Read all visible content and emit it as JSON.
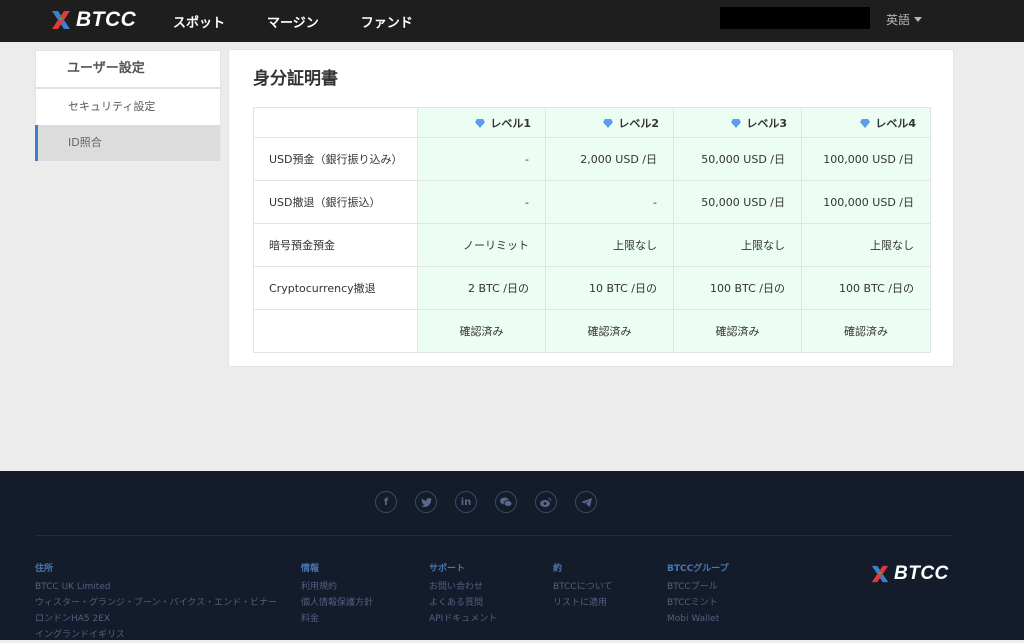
{
  "header": {
    "logo_text": "BTCC",
    "nav": [
      "スポット",
      "マージン",
      "ファンド"
    ],
    "language": "英語"
  },
  "sidebar": {
    "heading": "ユーザー設定",
    "items": [
      "セキュリティ設定",
      "ID照合"
    ],
    "active_index": 1
  },
  "main": {
    "title": "身分証明書",
    "levels": [
      "レベル1",
      "レベル2",
      "レベル3",
      "レベル4"
    ],
    "rows": [
      {
        "label": "USD預金（銀行振り込み）",
        "values": [
          "-",
          "2,000 USD /日",
          "50,000 USD /日",
          "100,000 USD /日"
        ]
      },
      {
        "label": "USD撤退（銀行振込）",
        "values": [
          "-",
          "-",
          "50,000 USD /日",
          "100,000 USD /日"
        ]
      },
      {
        "label": "暗号預金預金",
        "values": [
          "ノーリミット",
          "上限なし",
          "上限なし",
          "上限なし"
        ]
      },
      {
        "label": "Cryptocurrency撤退",
        "values": [
          "2 BTC /日の",
          "10 BTC /日の",
          "100 BTC /日の",
          "100 BTC /日の"
        ]
      }
    ],
    "status": [
      "確認済み",
      "確認済み",
      "確認済み",
      "確認済み"
    ]
  },
  "footer": {
    "social_icons": [
      "facebook-icon",
      "twitter-icon",
      "linkedin-icon",
      "wechat-icon",
      "weibo-icon",
      "telegram-icon"
    ],
    "columns": [
      {
        "title": "住所",
        "items": [
          "BTCC UK Limited",
          "ウィスター・グランジ・ブーン・バイクス・エンド・ビナー",
          "ロンドンHA5 2EX",
          "イングランドイギリス"
        ]
      },
      {
        "title": "情報",
        "items": [
          "利用規約",
          "個人情報保護方針",
          "料金"
        ]
      },
      {
        "title": "サポート",
        "items": [
          "お問い合わせ",
          "よくある質問",
          "APIドキュメント"
        ]
      },
      {
        "title": "約",
        "items": [
          "BTCCについて",
          "リストに適用"
        ]
      },
      {
        "title": "BTCCグループ",
        "items": [
          "BTCCプール",
          "BTCCミント",
          "Mobi Wallet"
        ]
      }
    ],
    "logo_text": "BTCC"
  },
  "colors": {
    "header_bg": "#1e1e1e",
    "level_cell_bg": "#ecfdf3",
    "verified_text": "#3fae5e",
    "active_accent": "#3c7fd0",
    "footer_bg": "#141b2a"
  }
}
